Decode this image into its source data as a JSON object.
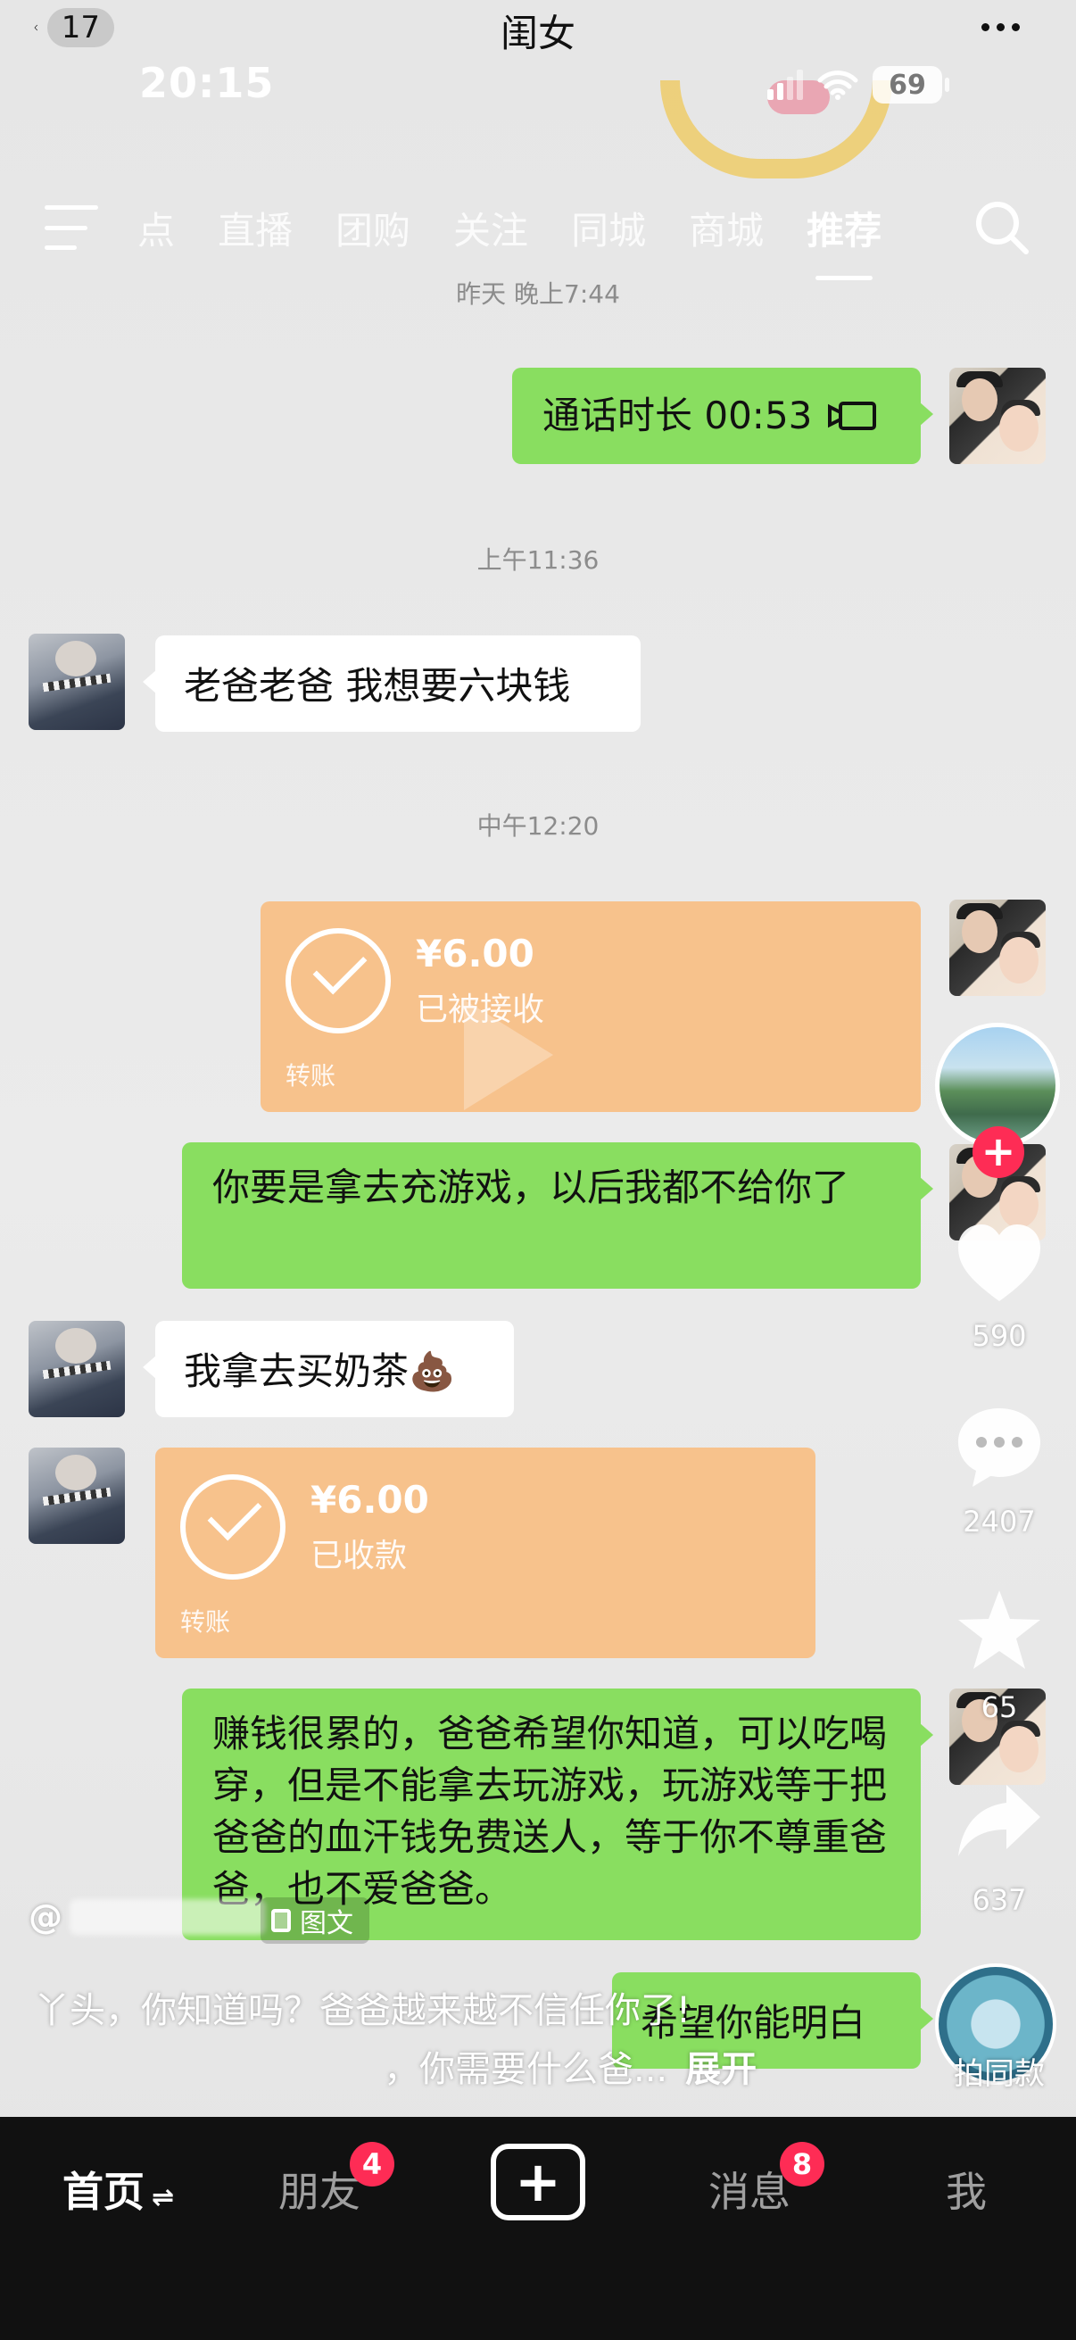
{
  "chat_header": {
    "back_count": "17",
    "title": "闺女",
    "more_icon": "more-dots-icon"
  },
  "status_bar": {
    "time": "20:15",
    "battery": "69"
  },
  "top_nav": {
    "tabs": [
      "点",
      "直播",
      "团购",
      "关注",
      "同城",
      "商城",
      "推荐"
    ],
    "active_tab": "推荐"
  },
  "messages": {
    "ts1": "昨天 晚上7:44",
    "call_text": "通话时长 00:53",
    "ts2": "上午11:36",
    "msg_six_yuan": "老爸老爸 我想要六块钱",
    "ts3": "中午12:20",
    "transfer1": {
      "amount": "¥6.00",
      "status": "已被接收",
      "label": "转账"
    },
    "msg_game_warning": "你要是拿去充游戏，以后我都不给你了",
    "msg_milk_tea": "我拿去买奶茶💩",
    "transfer2": {
      "amount": "¥6.00",
      "status": "已收款",
      "label": "转账"
    },
    "msg_long": "赚钱很累的，爸爸希望你知道，可以吃喝穿，但是不能拿去玩游戏，玩游戏等于把爸爸的血汗钱免费送人，等于你不尊重爸爸，也不爱爸爸。",
    "msg_last": "希望你能明白"
  },
  "rail": {
    "likes": "590",
    "comments": "2407",
    "favorites": "65",
    "shares": "637",
    "music_label": "拍同款"
  },
  "caption": {
    "at": "@",
    "type_tag": "图文",
    "line1": "丫头，你知道吗？爸爸越来越不信任你了!",
    "line2": "，你需要什么爸...",
    "expand": "展开"
  },
  "bottom_nav": {
    "home": "首页",
    "friends": "朋友",
    "friends_badge": "4",
    "messages": "消息",
    "messages_badge": "8",
    "me": "我"
  },
  "colors": {
    "wechat_green": "#89de60",
    "transfer_orange": "#f7c28c",
    "douyin_red": "#fe2c55",
    "nav_bg": "#111111"
  }
}
